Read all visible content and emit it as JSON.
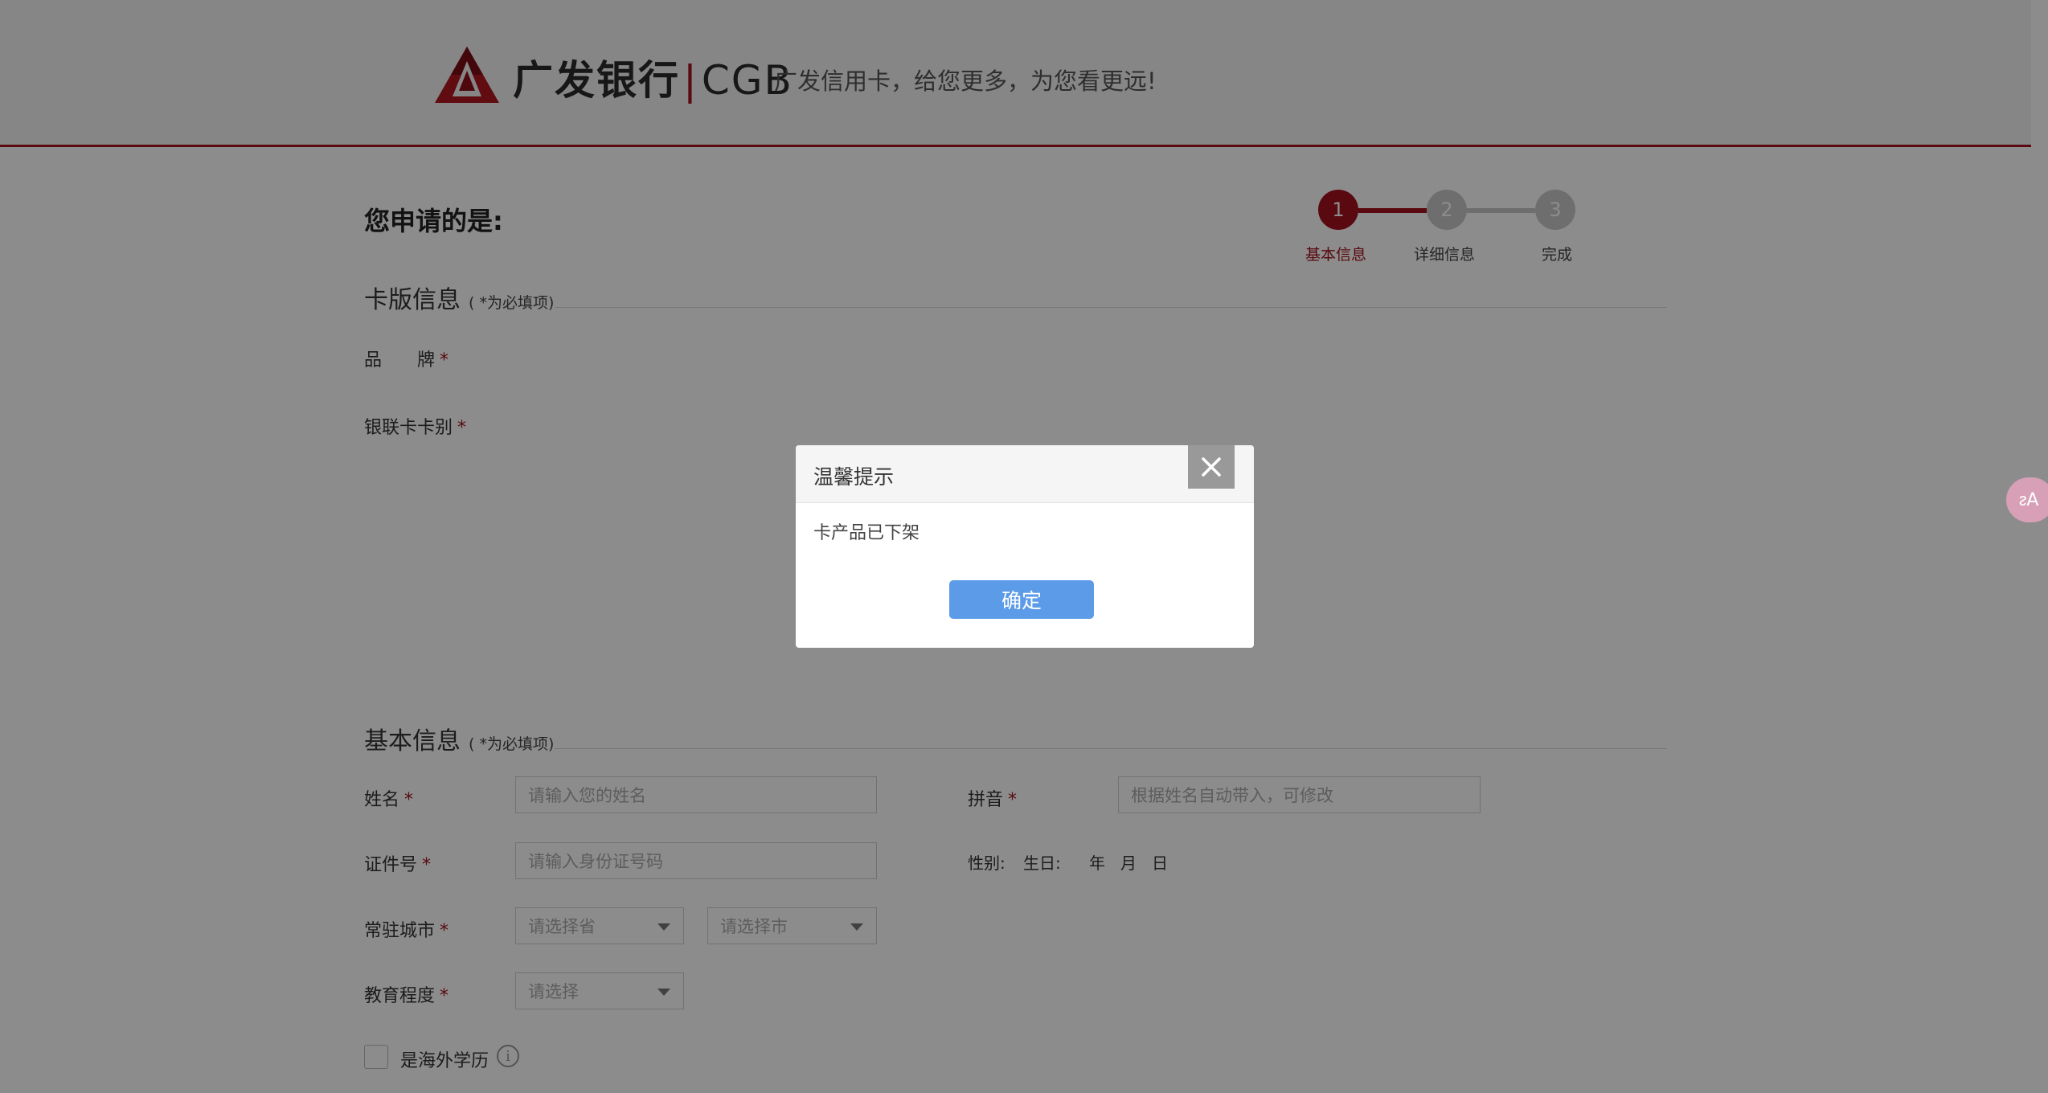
{
  "header": {
    "brand_cn": "广发银行",
    "brand_sep": "|",
    "brand_en": "CGB",
    "slogan": "广发信用卡，给您更多，为您看更远!"
  },
  "apply_title": "您申请的是:",
  "steps": [
    {
      "num": "1",
      "label": "基本信息"
    },
    {
      "num": "2",
      "label": "详细信息"
    },
    {
      "num": "3",
      "label": "完成"
    }
  ],
  "card_section": {
    "title": "卡版信息",
    "note": "( *为必填项)",
    "brand_label": "品　　牌",
    "unionpay_label": "银联卡卡别"
  },
  "basic_section": {
    "title": "基本信息",
    "note": "( *为必填项)",
    "name_label": "姓名",
    "name_placeholder": "请输入您的姓名",
    "pinyin_label": "拼音",
    "pinyin_placeholder": "根据姓名自动带入，可修改",
    "id_label": "证件号",
    "id_placeholder": "请输入身份证号码",
    "gender_label": "性别:",
    "birthday_label": "生日:",
    "year": "年",
    "month": "月",
    "day": "日",
    "city_label": "常驻城市",
    "province_placeholder": "请选择省",
    "city_placeholder": "请选择市",
    "education_label": "教育程度",
    "education_placeholder": "请选择",
    "overseas_label": "是海外学历",
    "required_mark": "*"
  },
  "modal": {
    "title": "温馨提示",
    "message": "卡产品已下架",
    "ok_label": "确定"
  },
  "translate_label": "ᴤA",
  "colors": {
    "brand_red": "#a3111c",
    "step_inactive": "#c9c9c9",
    "confirm_blue": "#5b9be8"
  }
}
